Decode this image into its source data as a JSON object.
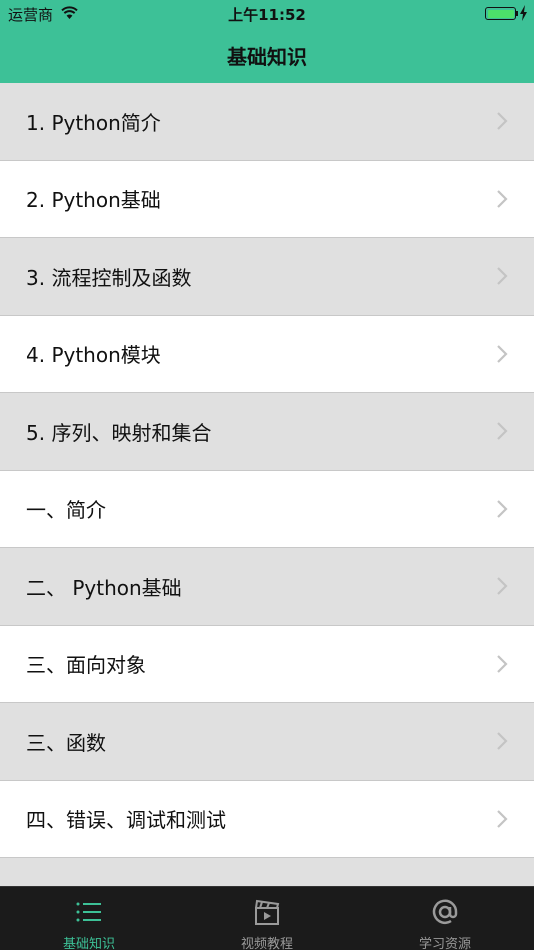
{
  "status_bar": {
    "carrier": "运营商",
    "time": "上午11:52"
  },
  "nav": {
    "title": "基础知识"
  },
  "list": {
    "items": [
      {
        "label": "1. Python简介"
      },
      {
        "label": "2. Python基础"
      },
      {
        "label": "3. 流程控制及函数"
      },
      {
        "label": "4. Python模块"
      },
      {
        "label": "5. 序列、映射和集合"
      },
      {
        "label": "一、简介"
      },
      {
        "label": "二、 Python基础"
      },
      {
        "label": "三、面向对象"
      },
      {
        "label": "三、函数"
      },
      {
        "label": "四、错误、调试和测试"
      }
    ]
  },
  "tabs": [
    {
      "label": "基础知识",
      "icon": "list-icon",
      "active": true
    },
    {
      "label": "视频教程",
      "icon": "video-clapper-icon",
      "active": false
    },
    {
      "label": "学习资源",
      "icon": "at-sign-icon",
      "active": false
    }
  ],
  "colors": {
    "accent": "#3dc197",
    "row_gray": "#e0e0e0",
    "tab_bar_bg": "#1b1b1b"
  }
}
